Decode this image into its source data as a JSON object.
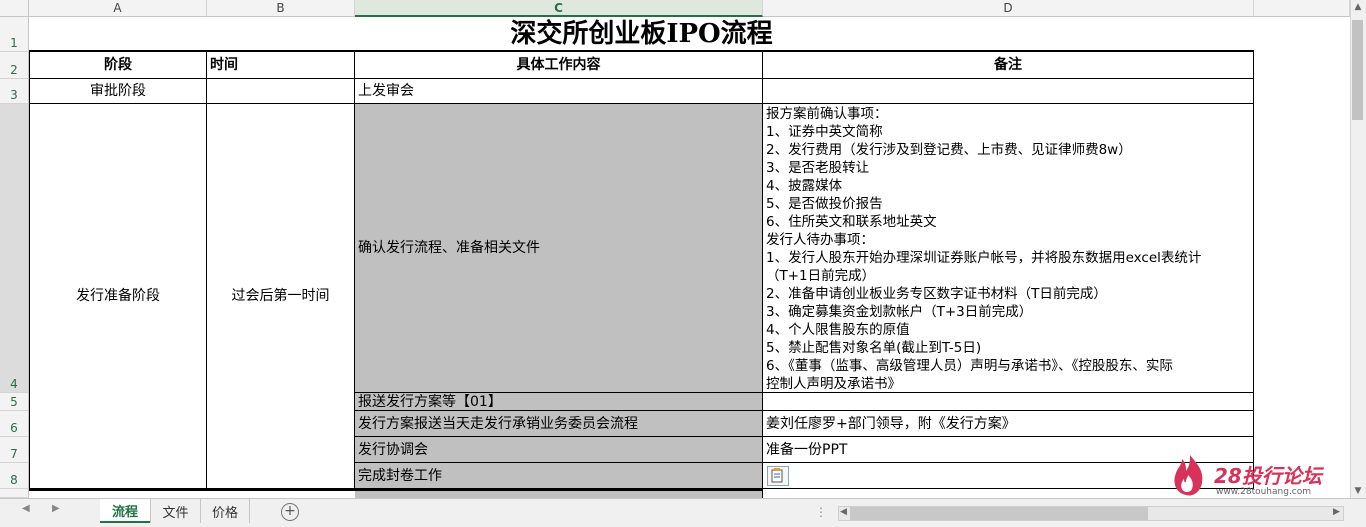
{
  "columns": [
    "A",
    "B",
    "C",
    "D"
  ],
  "rows": [
    "1",
    "2",
    "3",
    "4",
    "5",
    "6",
    "7",
    "8"
  ],
  "title": "深交所创业板IPO流程",
  "headers": {
    "stage": "阶段",
    "time": "时间",
    "content": "具体工作内容",
    "notes": "备注"
  },
  "row3": {
    "stage": "审批阶段",
    "content": "上发审会"
  },
  "row4": {
    "stage": "发行准备阶段",
    "time": "过会后第一时间",
    "content": "确认发行流程、准备相关文件",
    "notes": [
      "报方案前确认事项：",
      "1、证券中英文简称",
      "2、发行费用（发行涉及到登记费、上市费、见证律师费8w）",
      "3、是否老股转让",
      "4、披露媒体",
      "5、是否做投价报告",
      "6、住所英文和联系地址英文",
      "发行人待办事项：",
      "1、发行人股东开始办理深圳证券账户帐号，并将股东数据用excel表统计",
      "（T+1日前完成）",
      "2、准备申请创业板业务专区数字证书材料（T日前完成）",
      "3、确定募集资金划款帐户（T+3日前完成）",
      "4、个人限售股东的原值",
      "5、禁止配售对象名单(截止到T-5日)",
      "6、《董事（监事、高级管理人员）声明与承诺书》、《控股股东、实际",
      "控制人声明及承诺书》"
    ]
  },
  "row5": {
    "content": "报送发行方案等【01】"
  },
  "row6": {
    "content": "发行方案报送当天走发行承销业务委员会流程",
    "notes": "姜刘任廖罗+部门领导，附《发行方案》"
  },
  "row7": {
    "content": "发行协调会",
    "notes": "准备一份PPT"
  },
  "row8": {
    "content": "完成封卷工作"
  },
  "sheet_tabs": [
    "流程",
    "文件",
    "价格"
  ],
  "active_tab": "流程",
  "watermark": {
    "logo": "28投行论坛",
    "url": "www.28touhang.com"
  },
  "accent_color": "#217346"
}
